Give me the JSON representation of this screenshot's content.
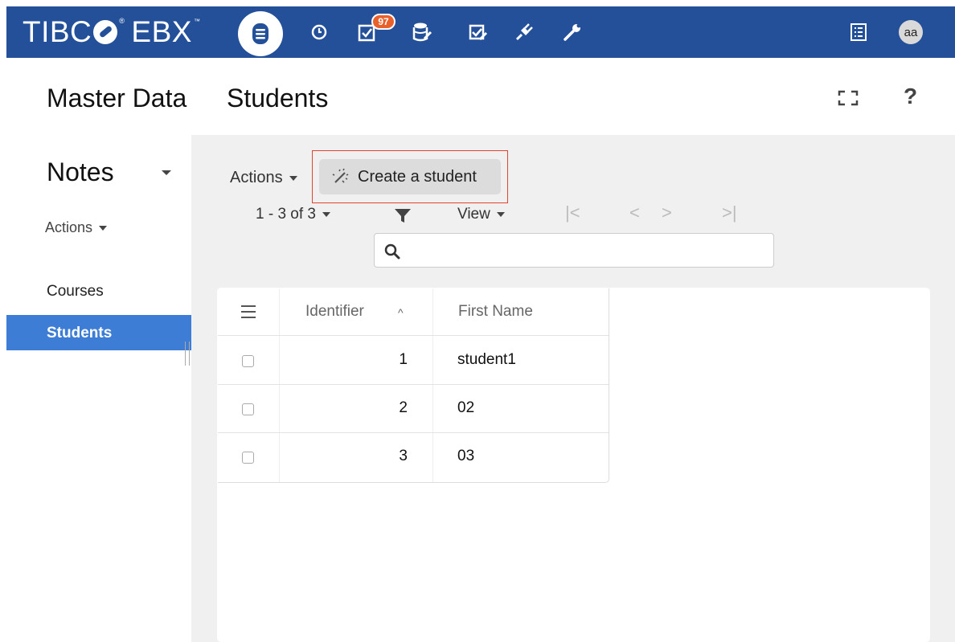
{
  "topbar": {
    "logo_left": "TIBC",
    "logo_reg": "®",
    "logo_right": "EBX",
    "logo_tm": "™",
    "nav_icons": [
      "database-icon",
      "clock-icon",
      "tasks-icon",
      "dataset-edit-icon",
      "validation-icon",
      "plugin-icon",
      "wrench-icon"
    ],
    "badge_count": "97",
    "user_initials": "aa",
    "accent_color": "#24509a",
    "badge_color": "#e8612c"
  },
  "header": {
    "app_title": "Master Data",
    "page_title": "Students",
    "help_label": "?"
  },
  "sidebar": {
    "dataset_title": "Notes",
    "actions_label": "Actions",
    "items": [
      {
        "label": "Courses",
        "selected": false
      },
      {
        "label": "Students",
        "selected": true
      }
    ],
    "selected_color": "#3d7dd6"
  },
  "toolbar": {
    "actions_label": "Actions",
    "create_label": "Create a student",
    "pager_label": "1 - 3 of 3",
    "view_label": "View",
    "first_label": "|<",
    "prev_label": "<",
    "next_label": ">",
    "last_label": ">|",
    "search_placeholder": ""
  },
  "table": {
    "columns": [
      "Identifier",
      "First Name"
    ],
    "sort_indicator": "^",
    "rows": [
      {
        "id": "1",
        "first_name": "student1"
      },
      {
        "id": "2",
        "first_name": "02"
      },
      {
        "id": "3",
        "first_name": "03"
      }
    ]
  }
}
